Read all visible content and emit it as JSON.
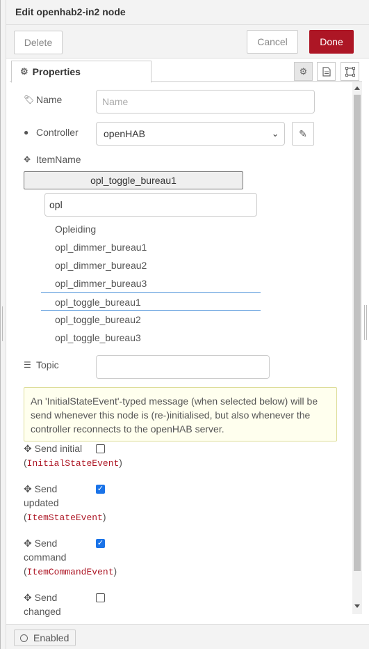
{
  "header": {
    "title": "Edit openhab2-in2 node"
  },
  "toolbar": {
    "delete_label": "Delete",
    "cancel_label": "Cancel",
    "done_label": "Done"
  },
  "colors": {
    "done": "#ad1625",
    "checkbox": "#1a73e8",
    "info_bg": "#ffffee",
    "mono_text": "#ad1625"
  },
  "tabs": {
    "properties_label": "Properties",
    "icons": [
      "gear-icon",
      "document-icon",
      "frame-icon"
    ]
  },
  "form": {
    "name": {
      "label": "Name",
      "placeholder": "Name",
      "value": ""
    },
    "controller": {
      "label": "Controller",
      "value": "openHAB"
    },
    "itemname": {
      "label": "ItemName",
      "selected": "opl_toggle_bureau1",
      "filter": "opl",
      "options": [
        "Opleiding",
        "opl_dimmer_bureau1",
        "opl_dimmer_bureau2",
        "opl_dimmer_bureau3",
        "opl_toggle_bureau1",
        "opl_toggle_bureau2",
        "opl_toggle_bureau3"
      ]
    },
    "topic": {
      "label": "Topic",
      "value": ""
    },
    "info": "An 'InitialStateEvent'-typed message (when selected below) will be send whenever this node is (re-)initialised, but also whenever the controller reconnects to the openHAB server.",
    "send_initial": {
      "label": "Send initial",
      "event": "InitialStateEvent",
      "checked": false
    },
    "send_updated": {
      "label_1": "Send",
      "label_2": "updated",
      "event": "ItemStateEvent",
      "checked": true
    },
    "send_command": {
      "label_1": "Send",
      "label_2": "command",
      "event": "ItemCommandEvent",
      "checked": true
    },
    "send_changed": {
      "label_1": "Send",
      "label_2": "changed",
      "checked": false
    }
  },
  "footer": {
    "enabled_label": "Enabled"
  }
}
